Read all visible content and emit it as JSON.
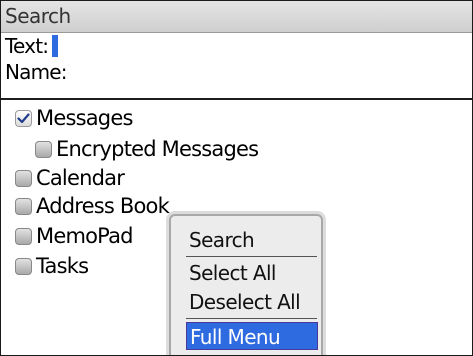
{
  "title_bar": {
    "title": "Search"
  },
  "fields": {
    "text_label": "Text:",
    "text_value": "",
    "name_label": "Name:",
    "name_value": ""
  },
  "categories": [
    {
      "label": "Messages",
      "checked": true
    },
    {
      "label": "Encrypted Messages",
      "checked": false
    },
    {
      "label": "Calendar",
      "checked": false
    },
    {
      "label": "Address Book",
      "checked": false
    },
    {
      "label": "MemoPad",
      "checked": false
    },
    {
      "label": "Tasks",
      "checked": false
    }
  ],
  "menu": {
    "items": [
      {
        "label": "Search",
        "selected": false
      },
      {
        "label": "Select All",
        "selected": false
      },
      {
        "label": "Deselect All",
        "selected": false
      },
      {
        "label": "Full Menu",
        "selected": true
      }
    ]
  },
  "colors": {
    "accent": "#2f6be0",
    "title_bar": "#d8d8d8",
    "checkmark": "#1f3f8a"
  }
}
